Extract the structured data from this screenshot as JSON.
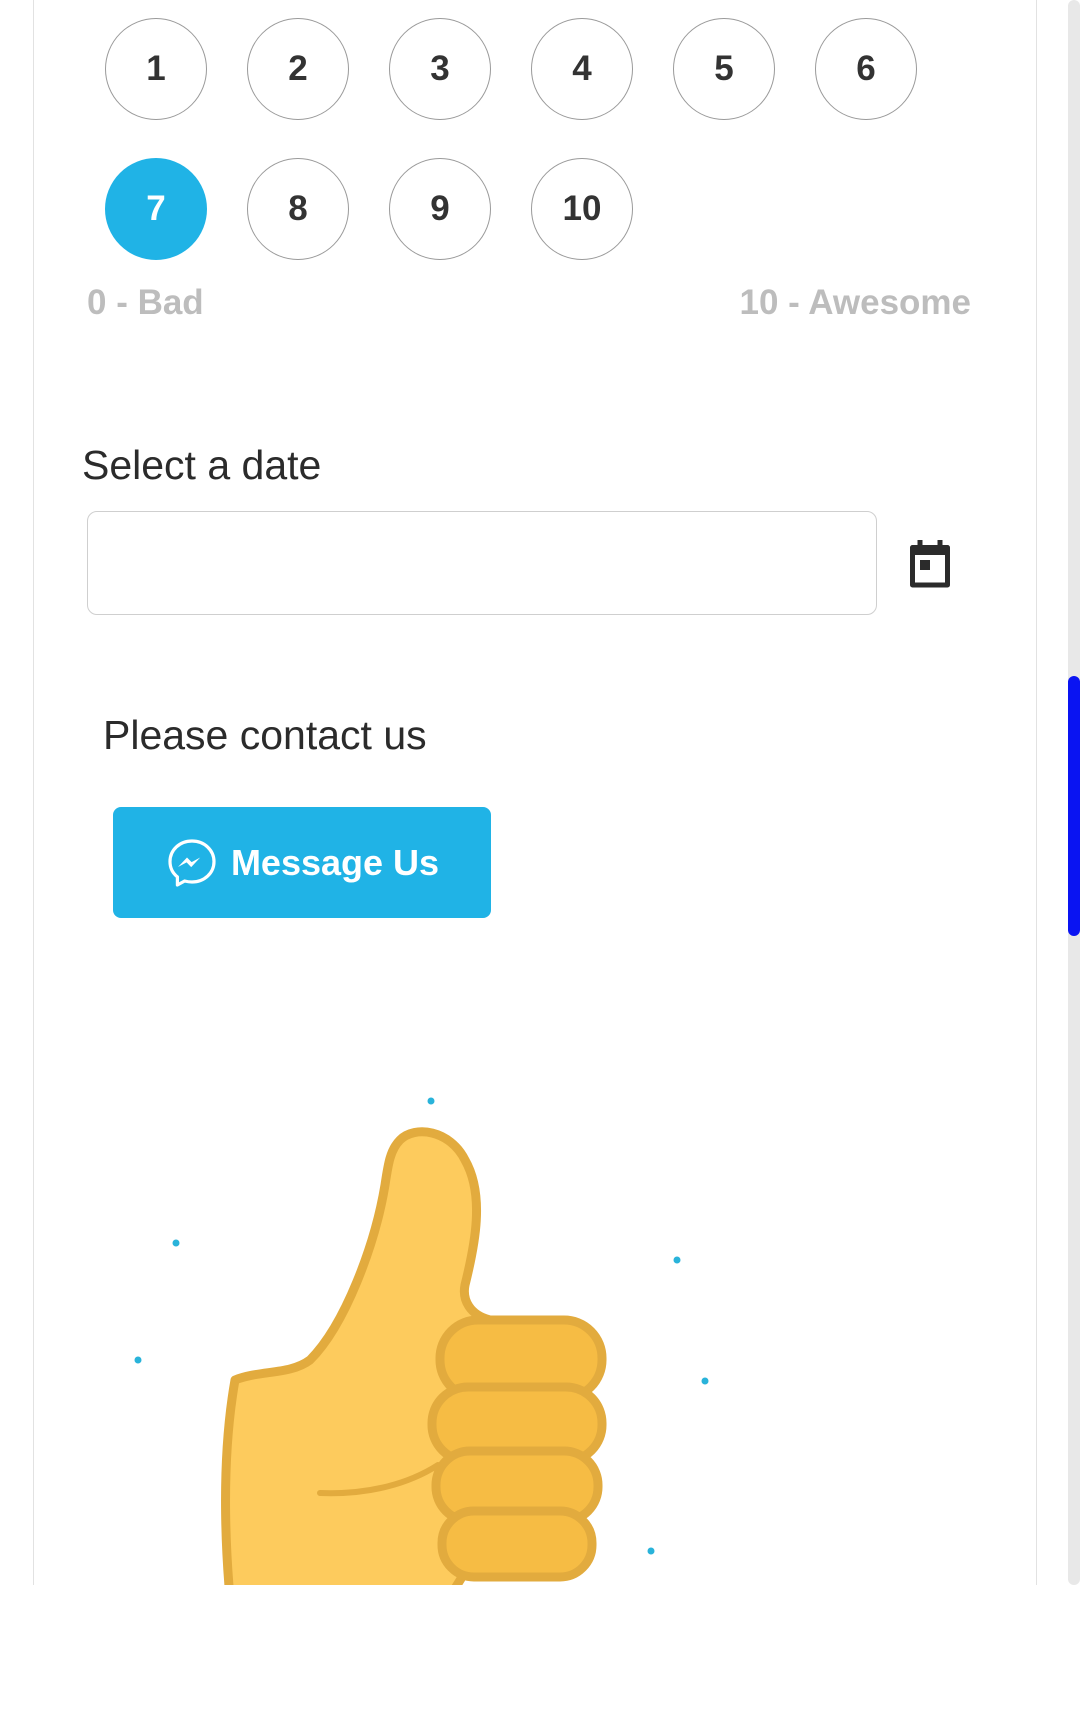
{
  "rating": {
    "options": [
      "1",
      "2",
      "3",
      "4",
      "5",
      "6",
      "7",
      "8",
      "9",
      "10"
    ],
    "selected": "7",
    "low_label": "0 - Bad",
    "high_label": "10 - Awesome",
    "accent_color": "#20b3e6"
  },
  "date": {
    "title": "Select a date",
    "value": "",
    "icon": "calendar-icon"
  },
  "contact": {
    "title": "Please contact us",
    "button_label": "Message Us",
    "button_icon": "messenger-icon",
    "button_color": "#20b3e6"
  },
  "illustration": {
    "icon": "thumbs-up-icon"
  },
  "scrollbar": {
    "thumb_color": "#0a14f2"
  }
}
